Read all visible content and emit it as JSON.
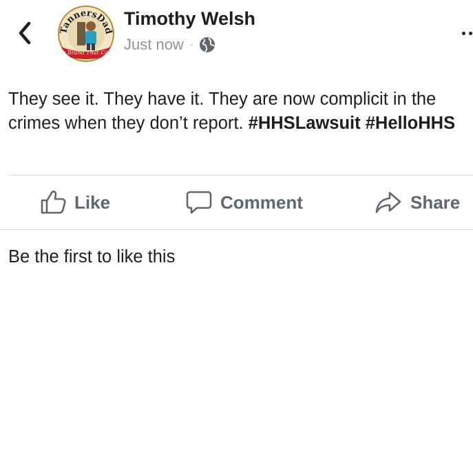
{
  "header": {
    "author_name": "Timothy Welsh",
    "timestamp": "Just now",
    "separator": "·",
    "audience_icon": "globe-icon",
    "back_icon": "chevron-left-icon",
    "more_icon": "more-dots-icon"
  },
  "avatar": {
    "top_text": "TannersDad",
    "bottom_text": "The Brand That Cares"
  },
  "post": {
    "text": "They see it. They have it. They are now complicit in the crimes when they don’t report. ",
    "hashtags": [
      "#HHSLawsuit",
      "#HelloHHS"
    ]
  },
  "actions": {
    "like_label": "Like",
    "comment_label": "Comment",
    "share_label": "Share",
    "like_icon": "thumbs-up-icon",
    "comment_icon": "comment-bubble-icon",
    "share_icon": "share-arrow-icon"
  },
  "reactions": {
    "prompt": "Be the first to like this"
  },
  "colors": {
    "text": "#1c1e21",
    "secondary_text": "#8d949e",
    "action_text": "#606770",
    "divider": "#dadde1",
    "avatar_ring": "#b8862f",
    "avatar_banner": "#c8202c"
  }
}
